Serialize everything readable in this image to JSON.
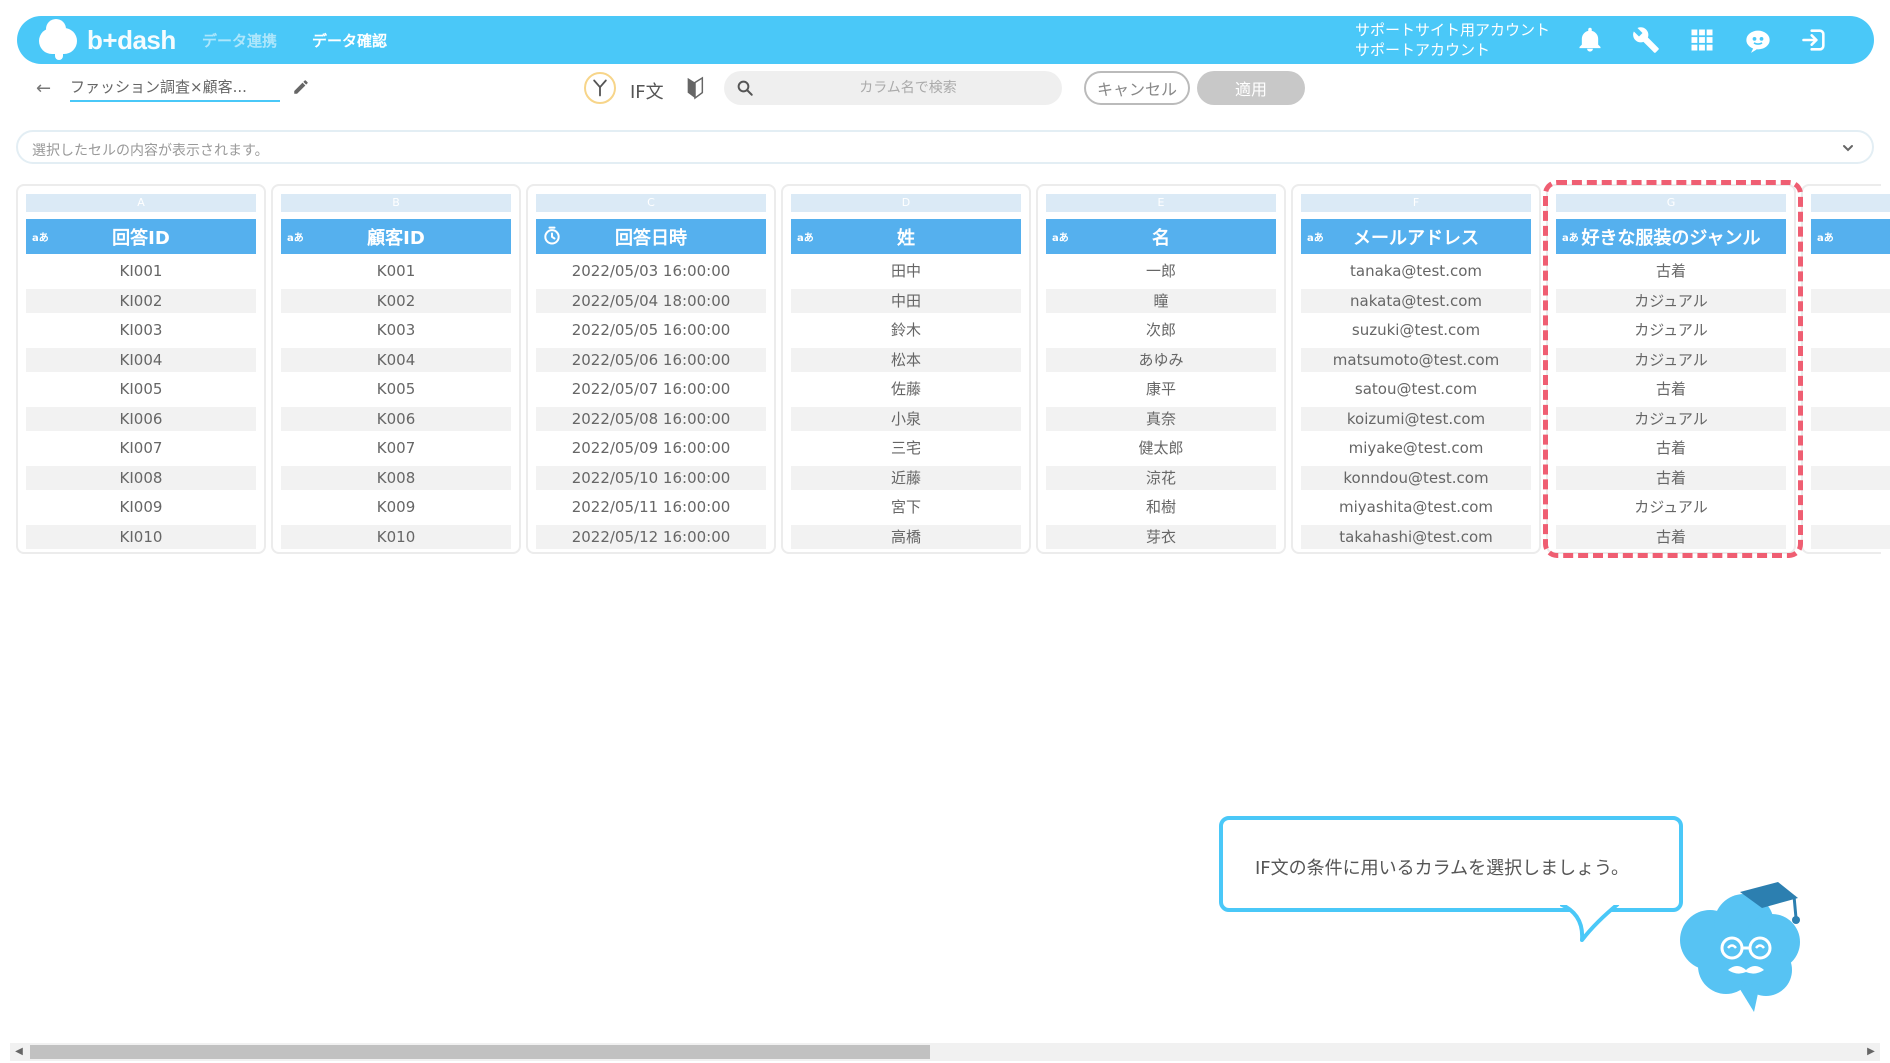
{
  "header": {
    "logo_text": "b+dash",
    "nav": [
      "データ連携",
      "データ確認"
    ],
    "account_line1": "サポートサイト用アカウント",
    "account_line2": "サポートアカウント",
    "icons": [
      "bell-icon",
      "wrench-icon",
      "apps-grid-icon",
      "chat-robot-icon",
      "logout-icon"
    ],
    "color": "#4ac8f8"
  },
  "toolbar": {
    "file_title": "ファッション調査×顧客...",
    "if_label": "IF文",
    "search_placeholder": "カラム名で検索",
    "cancel_label": "キャンセル",
    "apply_label": "適用"
  },
  "cellbar": {
    "placeholder": "選択したセルの内容が表示されます。"
  },
  "columns": [
    {
      "letter": "A",
      "type": "aあ",
      "name": "回答ID",
      "cells": [
        "KI001",
        "KI002",
        "KI003",
        "KI004",
        "KI005",
        "KI006",
        "KI007",
        "KI008",
        "KI009",
        "KI010"
      ]
    },
    {
      "letter": "B",
      "type": "aあ",
      "name": "顧客ID",
      "cells": [
        "K001",
        "K002",
        "K003",
        "K004",
        "K005",
        "K006",
        "K007",
        "K008",
        "K009",
        "K010"
      ]
    },
    {
      "letter": "C",
      "type": "clock",
      "name": "回答日時",
      "cells": [
        "2022/05/03 16:00:00",
        "2022/05/04 18:00:00",
        "2022/05/05 16:00:00",
        "2022/05/06 16:00:00",
        "2022/05/07 16:00:00",
        "2022/05/08 16:00:00",
        "2022/05/09 16:00:00",
        "2022/05/10 16:00:00",
        "2022/05/11 16:00:00",
        "2022/05/12 16:00:00"
      ]
    },
    {
      "letter": "D",
      "type": "aあ",
      "name": "姓",
      "cells": [
        "田中",
        "中田",
        "鈴木",
        "松本",
        "佐藤",
        "小泉",
        "三宅",
        "近藤",
        "宮下",
        "高橋"
      ]
    },
    {
      "letter": "E",
      "type": "aあ",
      "name": "名",
      "cells": [
        "一郎",
        "瞳",
        "次郎",
        "あゆみ",
        "康平",
        "真奈",
        "健太郎",
        "涼花",
        "和樹",
        "芽衣"
      ]
    },
    {
      "letter": "F",
      "type": "aあ",
      "name": "メールアドレス",
      "cells": [
        "tanaka@test.com",
        "nakata@test.com",
        "suzuki@test.com",
        "matsumoto@test.com",
        "satou@test.com",
        "koizumi@test.com",
        "miyake@test.com",
        "konndou@test.com",
        "miyashita@test.com",
        "takahashi@test.com"
      ]
    },
    {
      "letter": "G",
      "type": "aあ",
      "name": "好きな服装のジャンル",
      "cells": [
        "古着",
        "カジュアル",
        "カジュアル",
        "カジュアル",
        "古着",
        "カジュアル",
        "古着",
        "古着",
        "カジュアル",
        "古着"
      ]
    },
    {
      "letter": "",
      "type": "aあ",
      "name": "",
      "cells": [
        "",
        "",
        "",
        "",
        "",
        "",
        "",
        "",
        "",
        ""
      ]
    }
  ],
  "tooltip": {
    "text": "IF文の条件に用いるカラムを選択しましょう。",
    "border_color": "#4ac8f8"
  },
  "highlight_color": "#ef5e72"
}
